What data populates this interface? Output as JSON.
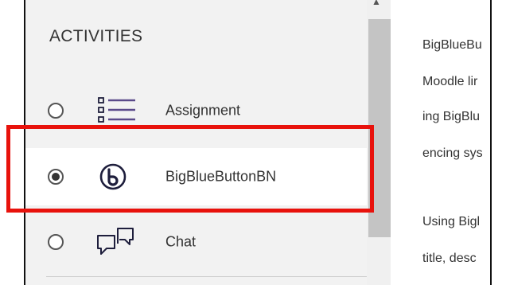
{
  "activities": {
    "heading": "ACTIVITIES",
    "items": [
      {
        "label": "Assignment",
        "icon": "assignment-list-icon",
        "selected": false
      },
      {
        "label": "BigBlueButtonBN",
        "icon": "bigbluebutton-icon",
        "selected": true
      },
      {
        "label": "Chat",
        "icon": "chat-icon",
        "selected": false
      }
    ]
  },
  "description": {
    "lines": [
      "BigBlueBu",
      "Moodle lir",
      "ing BigBlu",
      "encing sys",
      "Using Bigl",
      "title, desc"
    ]
  },
  "colors": {
    "highlight": "#e8120c",
    "panel_bg": "#f2f2f2",
    "selected_bg": "#ffffff",
    "icon_dark": "#1e1e3c",
    "icon_purple": "#5a4a8a"
  }
}
